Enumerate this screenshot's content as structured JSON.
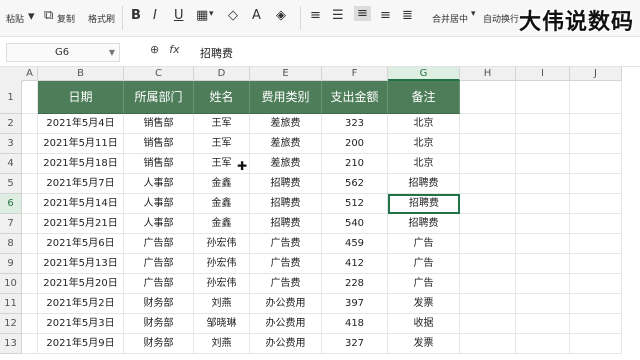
{
  "ribbon": {
    "paste_label": "粘贴",
    "copy_label": "复制",
    "format_painter_label": "格式刷",
    "bold_label": "B",
    "italic_label": "I",
    "underline_label": "U",
    "merge_label": "合并居中",
    "autowrap_label": "自动换行",
    "watermark_text": "大伟说数码"
  },
  "formula_bar": {
    "cell_ref": "G6",
    "fx_label": "fx",
    "content": "招聘费"
  },
  "columns": [
    "A",
    "B",
    "C",
    "D",
    "E",
    "F",
    "G",
    "H",
    "I",
    "J"
  ],
  "selected_column": "G",
  "selected_row": 6,
  "rows": [
    1,
    2,
    3,
    4,
    5,
    6,
    7,
    8,
    9,
    10,
    11,
    12,
    13
  ],
  "table": {
    "headers": [
      "日期",
      "所属部门",
      "姓名",
      "费用类别",
      "支出金额",
      "备注"
    ],
    "rows": [
      [
        "2021年5月4日",
        "销售部",
        "王军",
        "差旅费",
        "323",
        "北京"
      ],
      [
        "2021年5月11日",
        "销售部",
        "王军",
        "差旅费",
        "200",
        "北京"
      ],
      [
        "2021年5月18日",
        "销售部",
        "王军",
        "差旅费",
        "210",
        "北京"
      ],
      [
        "2021年5月7日",
        "人事部",
        "金鑫",
        "招聘费",
        "562",
        "招聘费"
      ],
      [
        "2021年5月14日",
        "人事部",
        "金鑫",
        "招聘费",
        "512",
        "招聘费"
      ],
      [
        "2021年5月21日",
        "人事部",
        "金鑫",
        "招聘费",
        "540",
        "招聘费"
      ],
      [
        "2021年5月6日",
        "广告部",
        "孙宏伟",
        "广告费",
        "459",
        "广告"
      ],
      [
        "2021年5月13日",
        "广告部",
        "孙宏伟",
        "广告费",
        "412",
        "广告"
      ],
      [
        "2021年5月20日",
        "广告部",
        "孙宏伟",
        "广告费",
        "228",
        "广告"
      ],
      [
        "2021年5月2日",
        "财务部",
        "刘燕",
        "办公费用",
        "397",
        "发票"
      ],
      [
        "2021年5月3日",
        "财务部",
        "邹晓琳",
        "办公费用",
        "418",
        "收据"
      ],
      [
        "2021年5月9日",
        "财务部",
        "刘燕",
        "办公费用",
        "327",
        "发票"
      ]
    ]
  },
  "colors": {
    "header_fill": "#4e7d5a",
    "selection": "#217346"
  }
}
